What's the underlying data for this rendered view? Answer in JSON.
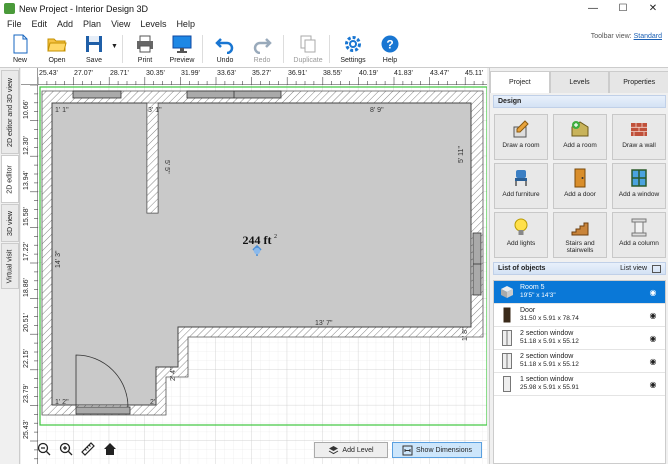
{
  "window": {
    "title": "New Project - Interior Design 3D"
  },
  "menu": [
    "File",
    "Edit",
    "Add",
    "Plan",
    "View",
    "Levels",
    "Help"
  ],
  "toolbar": {
    "buttons": [
      {
        "label": "New",
        "icon": "new-file-icon"
      },
      {
        "label": "Open",
        "icon": "folder-open-icon"
      },
      {
        "label": "Save",
        "icon": "floppy-disk-icon"
      },
      {
        "label": "Print",
        "icon": "printer-icon"
      },
      {
        "label": "Preview",
        "icon": "monitor-icon"
      },
      {
        "label": "Undo",
        "icon": "undo-icon"
      },
      {
        "label": "Redo",
        "icon": "redo-icon"
      },
      {
        "label": "Duplicate",
        "icon": "duplicate-icon"
      },
      {
        "label": "Settings",
        "icon": "gear-icon"
      },
      {
        "label": "Help",
        "icon": "help-icon"
      }
    ],
    "view_label": "Toolbar view:",
    "view_value": "Standard"
  },
  "side_tabs": [
    "2D editor and 3D view",
    "2D editor",
    "3D view",
    "Virtual visit"
  ],
  "ruler": {
    "h": [
      "25.43'",
      "27.07'",
      "28.71'",
      "30.35'",
      "31.99'",
      "33.63'",
      "35.27'",
      "36.91'",
      "38.55'",
      "40.19'",
      "41.83'",
      "43.47'",
      "45.11'"
    ],
    "v": [
      "10.66'",
      "12.30'",
      "13.94'",
      "15.58'",
      "17.22'",
      "18.86'",
      "20.51'",
      "22.15'",
      "23.79'",
      "25.43'"
    ]
  },
  "plan": {
    "area": "244 ft",
    "area_sup": "2",
    "dims": [
      "1' 1\"",
      "3' 1\"",
      "8' 9\"",
      "5' 5\"",
      "5' 11\"",
      "14' 3\"",
      "13' 7\"",
      "1' 8\"",
      "2' 4\"",
      "1' 2\"",
      "2'"
    ]
  },
  "bottom": {
    "add_level": "Add Level",
    "show_dimensions": "Show Dimensions"
  },
  "right": {
    "tabs": [
      "Project",
      "Levels",
      "Properties"
    ],
    "design_header": "Design",
    "design_buttons": [
      {
        "label": "Draw a room",
        "icon": "draw-room-icon"
      },
      {
        "label": "Add a room",
        "icon": "add-room-icon"
      },
      {
        "label": "Draw a wall",
        "icon": "brick-wall-icon"
      },
      {
        "label": "Add furniture",
        "icon": "chair-icon"
      },
      {
        "label": "Add a door",
        "icon": "door-icon"
      },
      {
        "label": "Add a window",
        "icon": "window-icon"
      },
      {
        "label": "Add lights",
        "icon": "lightbulb-icon"
      },
      {
        "label": "Stairs and stairwells",
        "icon": "stairs-icon"
      },
      {
        "label": "Add a column",
        "icon": "column-icon"
      }
    ],
    "list_header": "List of objects",
    "list_view": "List view",
    "objects": [
      {
        "name": "Room 5",
        "size": "19'5\" x 14'3\""
      },
      {
        "name": "Door",
        "size": "31.50 x 5.91 x 78.74"
      },
      {
        "name": "2 section window",
        "size": "51.18 x 5.91 x 55.12"
      },
      {
        "name": "2 section window",
        "size": "51.18 x 5.91 x 55.12"
      },
      {
        "name": "1 section window",
        "size": "25.98 x 5.91 x 55.91"
      }
    ]
  }
}
